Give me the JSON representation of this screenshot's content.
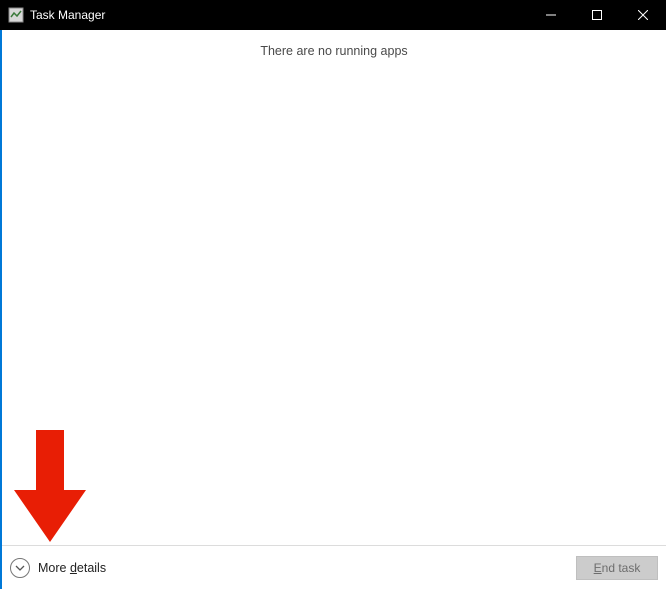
{
  "titlebar": {
    "title": "Task Manager"
  },
  "content": {
    "empty_message": "There are no running apps"
  },
  "footer": {
    "more_details_prefix": "More ",
    "more_details_uletter": "d",
    "more_details_suffix": "etails",
    "end_task_uletter": "E",
    "end_task_suffix": "nd task"
  },
  "colors": {
    "arrow": "#e81e05"
  }
}
